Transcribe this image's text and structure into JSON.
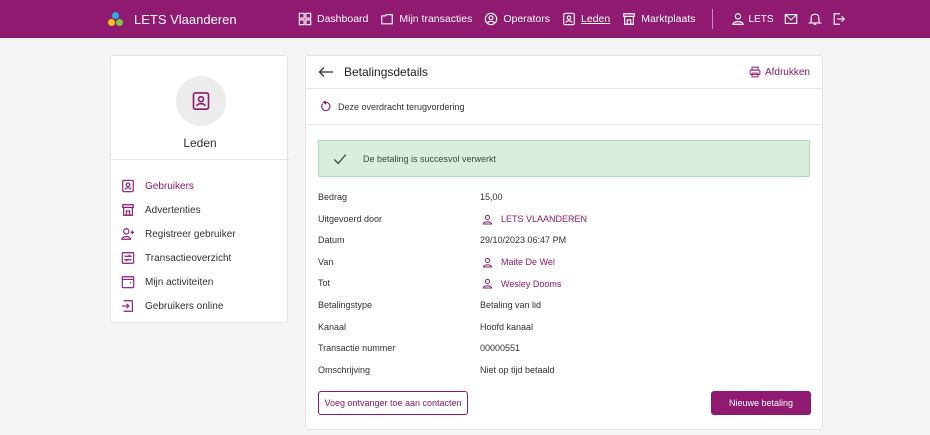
{
  "app": {
    "brand": "LETS Vlaanderen",
    "accent": "#8f1a6f"
  },
  "nav": {
    "items": [
      {
        "label": "Dashboard",
        "icon": "dashboard-icon"
      },
      {
        "label": "Mijn transacties",
        "icon": "folder-icon"
      },
      {
        "label": "Operators",
        "icon": "operator-icon"
      },
      {
        "label": "Leden",
        "icon": "member-card-icon",
        "active": true
      },
      {
        "label": "Marktplaats",
        "icon": "store-icon"
      }
    ],
    "user_label": "LETS"
  },
  "sidebar": {
    "title": "Leden",
    "items": [
      {
        "label": "Gebruikers",
        "icon": "member-card-icon",
        "active": true
      },
      {
        "label": "Advertenties",
        "icon": "store-icon"
      },
      {
        "label": "Registreer gebruiker",
        "icon": "user-plus-icon"
      },
      {
        "label": "Transactieoverzicht",
        "icon": "transfer-icon"
      },
      {
        "label": "Mijn activiteiten",
        "icon": "calendar-icon"
      },
      {
        "label": "Gebruikers online",
        "icon": "login-icon"
      }
    ]
  },
  "main": {
    "title": "Betalingsdetails",
    "print_label": "Afdrukken",
    "reclaim_label": "Deze overdracht terugvordering",
    "success_message": "De betaling is succesvol verwerkt",
    "details": [
      {
        "label": "Bedrag",
        "value": "15,00"
      },
      {
        "label": "Uitgevoerd door",
        "value": "LETS VLAANDEREN",
        "link": true
      },
      {
        "label": "Datum",
        "value": "29/10/2023 06:47 PM"
      },
      {
        "label": "Van",
        "value": "Maite De Wel",
        "link": true
      },
      {
        "label": "Tot",
        "value": "Wesley Dooms",
        "link": true
      },
      {
        "label": "Betalingstype",
        "value": "Betaling van lid"
      },
      {
        "label": "Kanaal",
        "value": "Hoofd kanaal"
      },
      {
        "label": "Transactie nummer",
        "value": "00000551"
      },
      {
        "label": "Omschrijving",
        "value": "Niet op tijd betaald"
      }
    ],
    "add_contact_label": "Voeg ontvanger toe aan contacten",
    "new_payment_label": "Nieuwe betaling"
  }
}
